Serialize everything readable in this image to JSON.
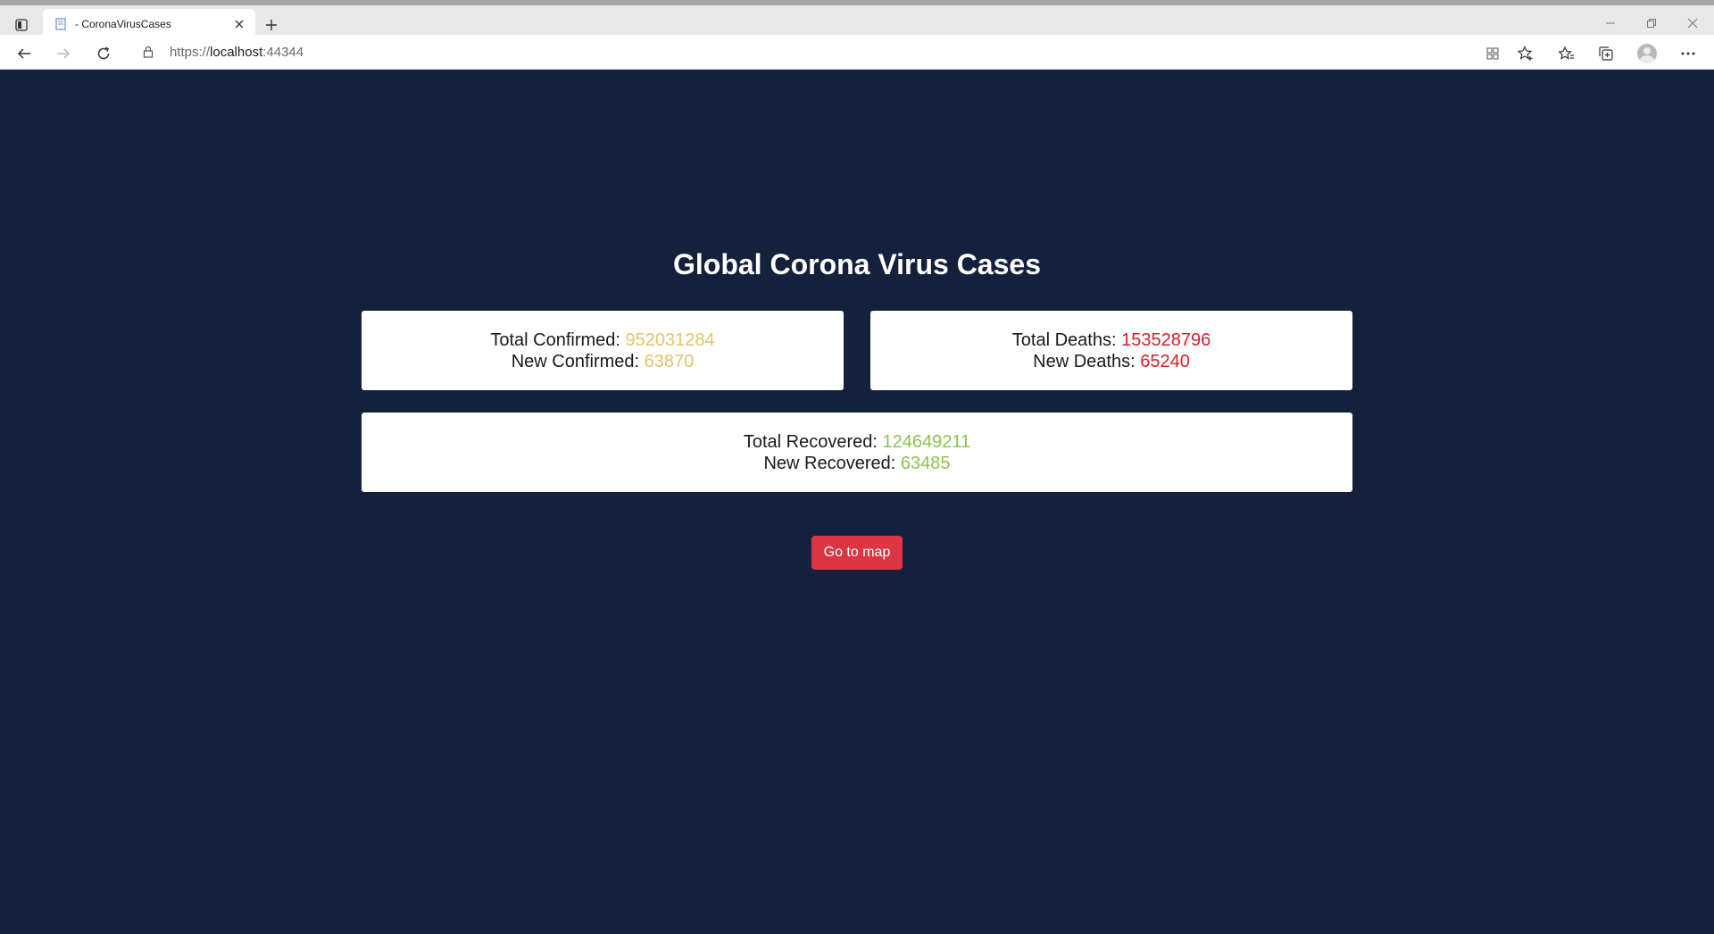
{
  "browser": {
    "tab_title": "- CoronaVirusCases",
    "url_scheme": "https://",
    "url_host": "localhost",
    "url_port": ":44344"
  },
  "page": {
    "title": "Global Corona Virus Cases",
    "confirmed": {
      "total_label": "Total Confirmed: ",
      "total_value": "952031284",
      "new_label": "New Confirmed: ",
      "new_value": "63870"
    },
    "deaths": {
      "total_label": "Total Deaths: ",
      "total_value": "153528796",
      "new_label": "New Deaths: ",
      "new_value": "65240"
    },
    "recovered": {
      "total_label": "Total Recovered: ",
      "total_value": "124649211",
      "new_label": "New Recovered: ",
      "new_value": "63485"
    },
    "map_button_label": "Go to map"
  },
  "colors": {
    "background": "#14213d",
    "confirmed_accent": "#e2c467",
    "deaths_accent": "#d21f2c",
    "recovered_accent": "#8bc34a",
    "button": "#dc3545"
  }
}
